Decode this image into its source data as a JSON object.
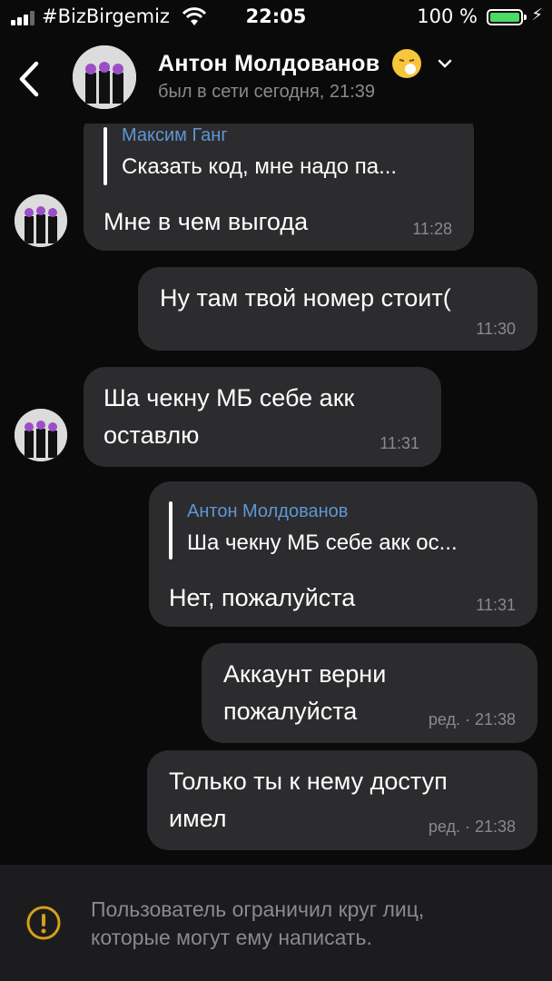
{
  "status_bar": {
    "carrier": "#BizBirgemiz",
    "time": "22:05",
    "battery": "100 %"
  },
  "header": {
    "contact_name": "Антон Молдованов",
    "last_seen": "был в сети сегодня, 21:39",
    "status_emoji": "sneezing-face-emoji"
  },
  "messages": [
    {
      "direction": "incoming",
      "reply_to": {
        "author": "Максим Ганг",
        "text": "Сказать код, мне надо па..."
      },
      "lines": [
        "Мне в чем выгода"
      ],
      "time": "11:28"
    },
    {
      "direction": "outgoing",
      "lines": [
        "Ну там твой номер стоит("
      ],
      "time": "11:30"
    },
    {
      "direction": "incoming",
      "lines": [
        "Ша чекну МБ себе акк",
        "оставлю"
      ],
      "time": "11:31"
    },
    {
      "direction": "outgoing",
      "reply_to": {
        "author": "Антон Молдованов",
        "text": "Ша чекну МБ себе акк ос..."
      },
      "lines": [
        "Нет, пожалуйста"
      ],
      "time": "11:31"
    },
    {
      "direction": "outgoing",
      "lines": [
        "Аккаунт верни",
        "пожалуйста"
      ],
      "time": "ред. · 21:38"
    },
    {
      "direction": "outgoing",
      "lines": [
        "Только ты к нему доступ",
        "имел"
      ],
      "time": "ред. · 21:38"
    }
  ],
  "footer": {
    "notice_line1": "Пользователь ограничил круг лиц,",
    "notice_line2": "которые могут ему написать."
  },
  "colors": {
    "background": "#0a0a0a",
    "bubble": "#2c2c2e",
    "reply_author": "#5f95d5",
    "secondary_text": "#8a8a8e",
    "warning": "#d4a017",
    "battery": "#4cd964"
  }
}
